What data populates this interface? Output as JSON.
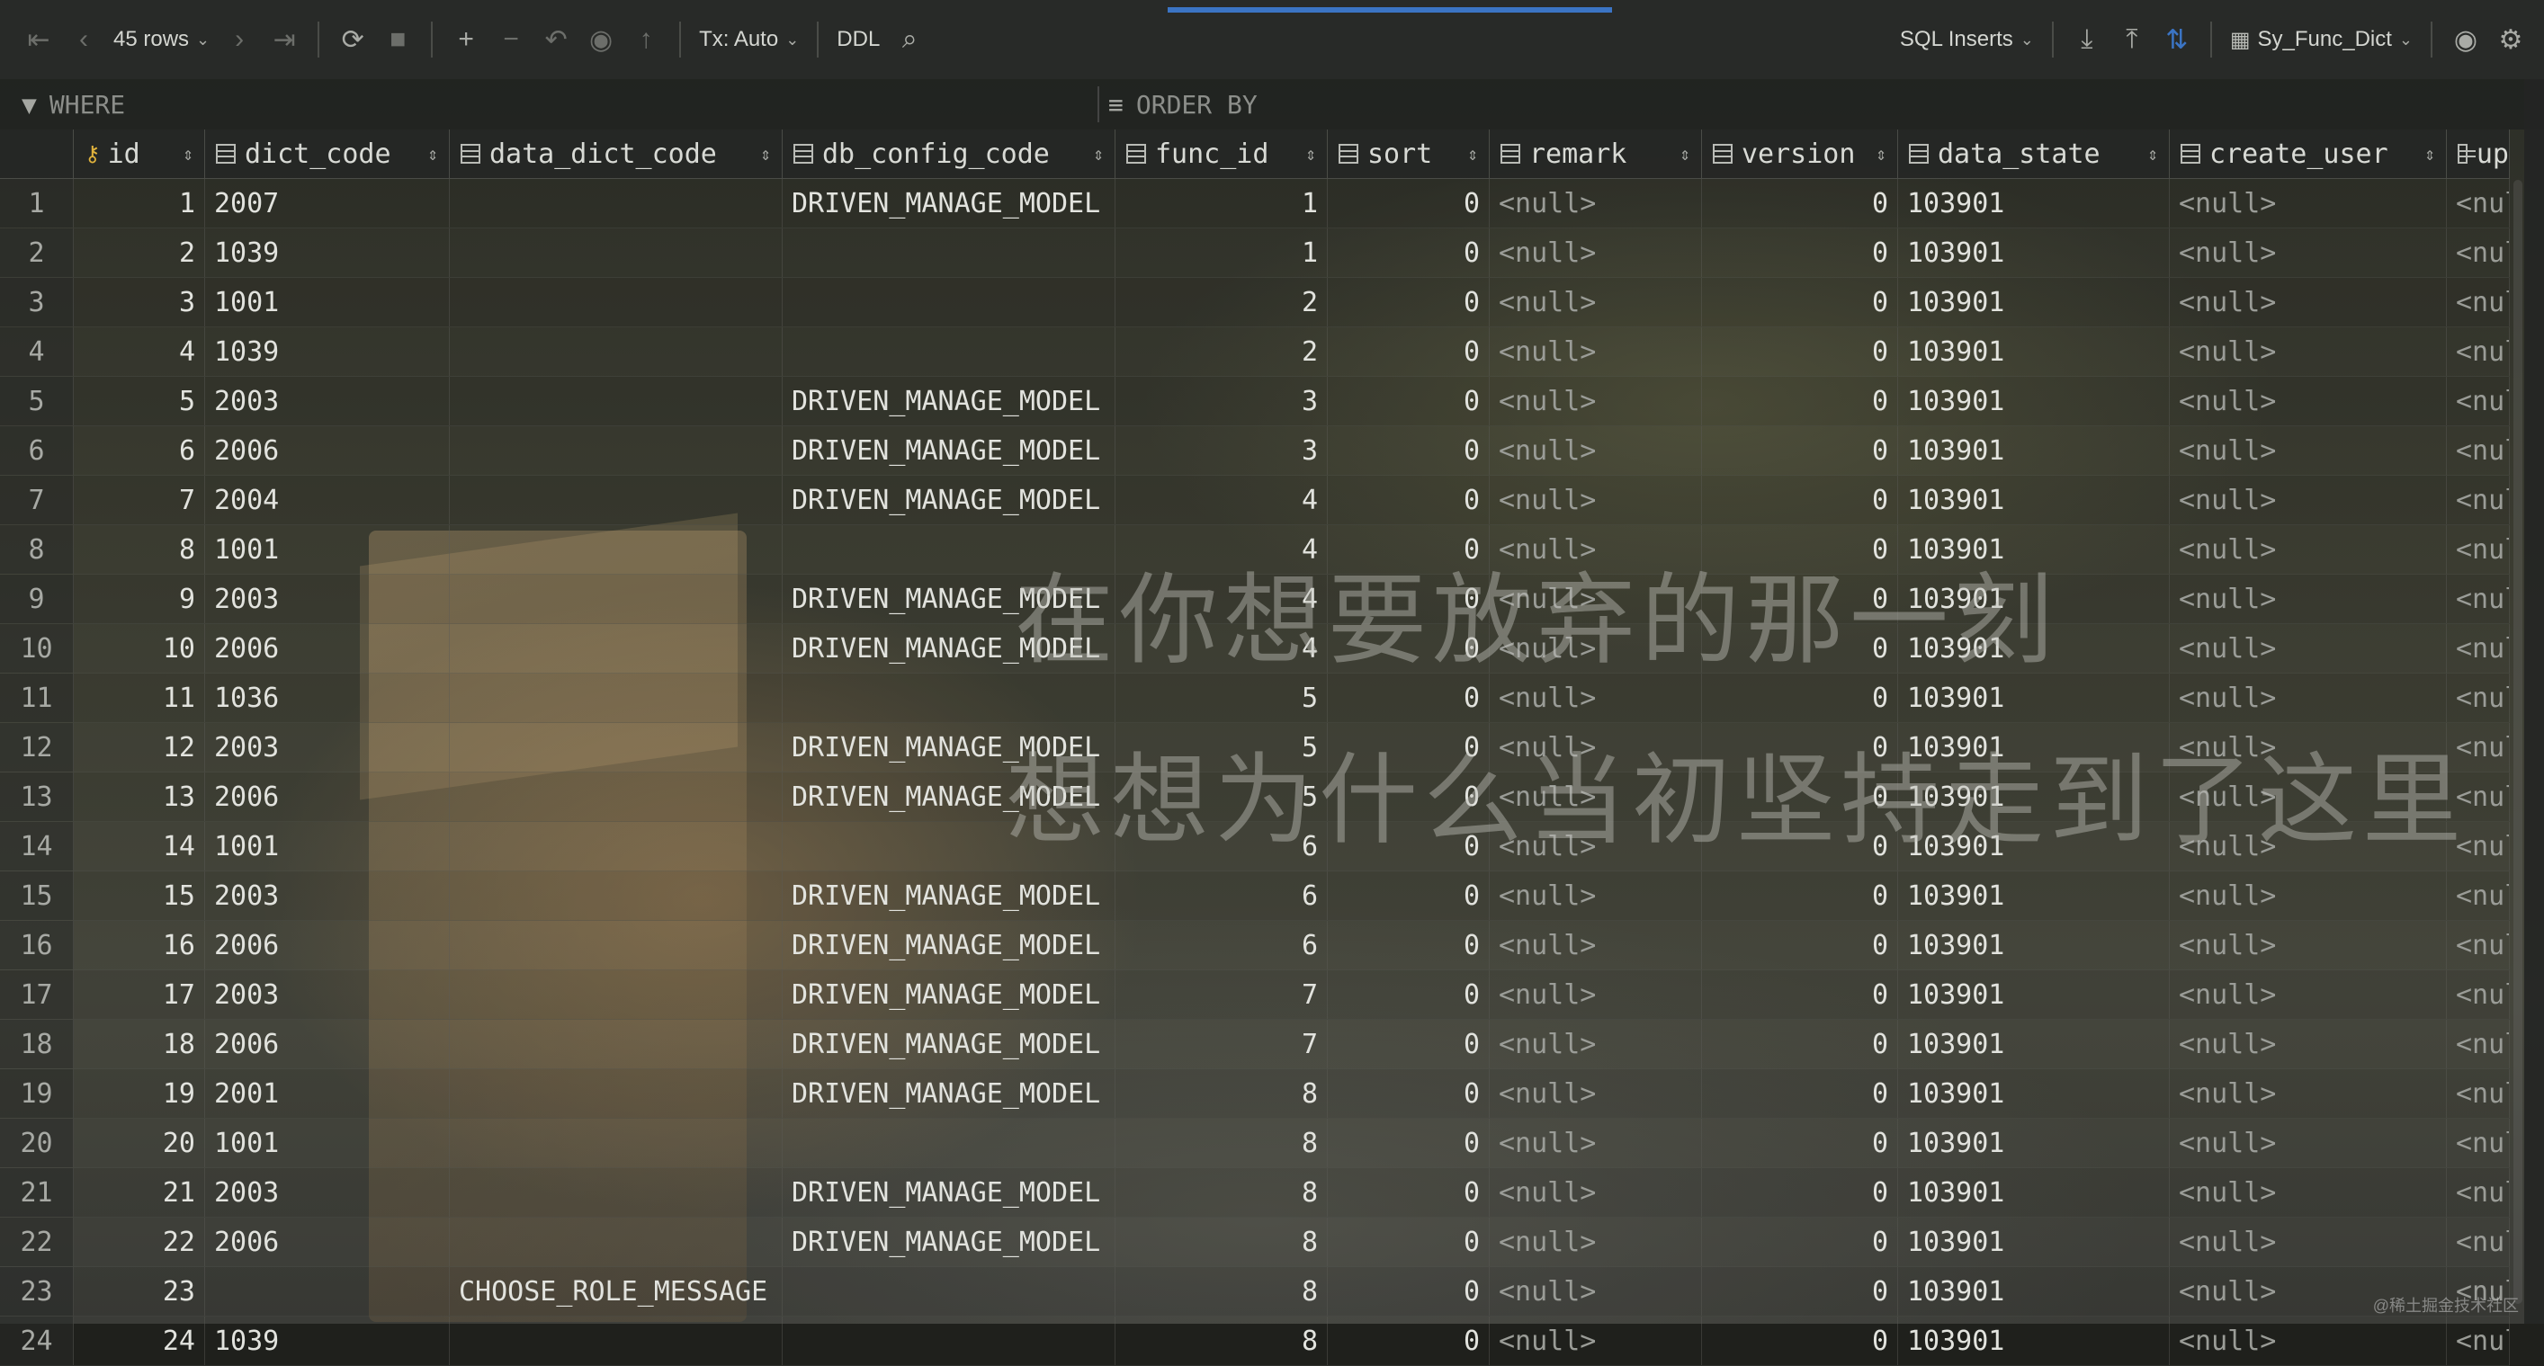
{
  "toolbar": {
    "rows_label": "45 rows",
    "tx_label": "Tx: Auto",
    "ddl_label": "DDL",
    "export_format": "SQL Inserts",
    "table_name": "Sy_Func_Dict"
  },
  "filter": {
    "where_label": "WHERE",
    "order_label": "ORDER BY"
  },
  "columns": [
    "id",
    "dict_code",
    "data_dict_code",
    "db_config_code",
    "func_id",
    "sort",
    "remark",
    "version",
    "data_state",
    "create_user",
    "up"
  ],
  "rows": [
    {
      "rn": "1",
      "id": "1",
      "dict_code": "2007",
      "data_dict_code": "",
      "db_config_code": "DRIVEN_MANAGE_MODEL",
      "func_id": "1",
      "sort": "0",
      "remark": "<null>",
      "version": "0",
      "data_state": "103901",
      "create_user": "<null>",
      "up": "<nul"
    },
    {
      "rn": "2",
      "id": "2",
      "dict_code": "1039",
      "data_dict_code": "",
      "db_config_code": "",
      "func_id": "1",
      "sort": "0",
      "remark": "<null>",
      "version": "0",
      "data_state": "103901",
      "create_user": "<null>",
      "up": "<nul"
    },
    {
      "rn": "3",
      "id": "3",
      "dict_code": "1001",
      "data_dict_code": "",
      "db_config_code": "",
      "func_id": "2",
      "sort": "0",
      "remark": "<null>",
      "version": "0",
      "data_state": "103901",
      "create_user": "<null>",
      "up": "<nul"
    },
    {
      "rn": "4",
      "id": "4",
      "dict_code": "1039",
      "data_dict_code": "",
      "db_config_code": "",
      "func_id": "2",
      "sort": "0",
      "remark": "<null>",
      "version": "0",
      "data_state": "103901",
      "create_user": "<null>",
      "up": "<nul"
    },
    {
      "rn": "5",
      "id": "5",
      "dict_code": "2003",
      "data_dict_code": "",
      "db_config_code": "DRIVEN_MANAGE_MODEL",
      "func_id": "3",
      "sort": "0",
      "remark": "<null>",
      "version": "0",
      "data_state": "103901",
      "create_user": "<null>",
      "up": "<nul"
    },
    {
      "rn": "6",
      "id": "6",
      "dict_code": "2006",
      "data_dict_code": "",
      "db_config_code": "DRIVEN_MANAGE_MODEL",
      "func_id": "3",
      "sort": "0",
      "remark": "<null>",
      "version": "0",
      "data_state": "103901",
      "create_user": "<null>",
      "up": "<nul"
    },
    {
      "rn": "7",
      "id": "7",
      "dict_code": "2004",
      "data_dict_code": "",
      "db_config_code": "DRIVEN_MANAGE_MODEL",
      "func_id": "4",
      "sort": "0",
      "remark": "<null>",
      "version": "0",
      "data_state": "103901",
      "create_user": "<null>",
      "up": "<nul"
    },
    {
      "rn": "8",
      "id": "8",
      "dict_code": "1001",
      "data_dict_code": "",
      "db_config_code": "",
      "func_id": "4",
      "sort": "0",
      "remark": "<null>",
      "version": "0",
      "data_state": "103901",
      "create_user": "<null>",
      "up": "<nul"
    },
    {
      "rn": "9",
      "id": "9",
      "dict_code": "2003",
      "data_dict_code": "",
      "db_config_code": "DRIVEN_MANAGE_MODEL",
      "func_id": "4",
      "sort": "0",
      "remark": "<null>",
      "version": "0",
      "data_state": "103901",
      "create_user": "<null>",
      "up": "<nul"
    },
    {
      "rn": "10",
      "id": "10",
      "dict_code": "2006",
      "data_dict_code": "",
      "db_config_code": "DRIVEN_MANAGE_MODEL",
      "func_id": "4",
      "sort": "0",
      "remark": "<null>",
      "version": "0",
      "data_state": "103901",
      "create_user": "<null>",
      "up": "<nul"
    },
    {
      "rn": "11",
      "id": "11",
      "dict_code": "1036",
      "data_dict_code": "",
      "db_config_code": "",
      "func_id": "5",
      "sort": "0",
      "remark": "<null>",
      "version": "0",
      "data_state": "103901",
      "create_user": "<null>",
      "up": "<nul"
    },
    {
      "rn": "12",
      "id": "12",
      "dict_code": "2003",
      "data_dict_code": "",
      "db_config_code": "DRIVEN_MANAGE_MODEL",
      "func_id": "5",
      "sort": "0",
      "remark": "<null>",
      "version": "0",
      "data_state": "103901",
      "create_user": "<null>",
      "up": "<nul"
    },
    {
      "rn": "13",
      "id": "13",
      "dict_code": "2006",
      "data_dict_code": "",
      "db_config_code": "DRIVEN_MANAGE_MODEL",
      "func_id": "5",
      "sort": "0",
      "remark": "<null>",
      "version": "0",
      "data_state": "103901",
      "create_user": "<null>",
      "up": "<nul"
    },
    {
      "rn": "14",
      "id": "14",
      "dict_code": "1001",
      "data_dict_code": "",
      "db_config_code": "",
      "func_id": "6",
      "sort": "0",
      "remark": "<null>",
      "version": "0",
      "data_state": "103901",
      "create_user": "<null>",
      "up": "<nul"
    },
    {
      "rn": "15",
      "id": "15",
      "dict_code": "2003",
      "data_dict_code": "",
      "db_config_code": "DRIVEN_MANAGE_MODEL",
      "func_id": "6",
      "sort": "0",
      "remark": "<null>",
      "version": "0",
      "data_state": "103901",
      "create_user": "<null>",
      "up": "<nul"
    },
    {
      "rn": "16",
      "id": "16",
      "dict_code": "2006",
      "data_dict_code": "",
      "db_config_code": "DRIVEN_MANAGE_MODEL",
      "func_id": "6",
      "sort": "0",
      "remark": "<null>",
      "version": "0",
      "data_state": "103901",
      "create_user": "<null>",
      "up": "<nul"
    },
    {
      "rn": "17",
      "id": "17",
      "dict_code": "2003",
      "data_dict_code": "",
      "db_config_code": "DRIVEN_MANAGE_MODEL",
      "func_id": "7",
      "sort": "0",
      "remark": "<null>",
      "version": "0",
      "data_state": "103901",
      "create_user": "<null>",
      "up": "<nul"
    },
    {
      "rn": "18",
      "id": "18",
      "dict_code": "2006",
      "data_dict_code": "",
      "db_config_code": "DRIVEN_MANAGE_MODEL",
      "func_id": "7",
      "sort": "0",
      "remark": "<null>",
      "version": "0",
      "data_state": "103901",
      "create_user": "<null>",
      "up": "<nul"
    },
    {
      "rn": "19",
      "id": "19",
      "dict_code": "2001",
      "data_dict_code": "",
      "db_config_code": "DRIVEN_MANAGE_MODEL",
      "func_id": "8",
      "sort": "0",
      "remark": "<null>",
      "version": "0",
      "data_state": "103901",
      "create_user": "<null>",
      "up": "<nul"
    },
    {
      "rn": "20",
      "id": "20",
      "dict_code": "1001",
      "data_dict_code": "",
      "db_config_code": "",
      "func_id": "8",
      "sort": "0",
      "remark": "<null>",
      "version": "0",
      "data_state": "103901",
      "create_user": "<null>",
      "up": "<nul"
    },
    {
      "rn": "21",
      "id": "21",
      "dict_code": "2003",
      "data_dict_code": "",
      "db_config_code": "DRIVEN_MANAGE_MODEL",
      "func_id": "8",
      "sort": "0",
      "remark": "<null>",
      "version": "0",
      "data_state": "103901",
      "create_user": "<null>",
      "up": "<nul"
    },
    {
      "rn": "22",
      "id": "22",
      "dict_code": "2006",
      "data_dict_code": "",
      "db_config_code": "DRIVEN_MANAGE_MODEL",
      "func_id": "8",
      "sort": "0",
      "remark": "<null>",
      "version": "0",
      "data_state": "103901",
      "create_user": "<null>",
      "up": "<nul"
    },
    {
      "rn": "23",
      "id": "23",
      "dict_code": "",
      "data_dict_code": "CHOOSE_ROLE_MESSAGE",
      "db_config_code": "",
      "func_id": "8",
      "sort": "0",
      "remark": "<null>",
      "version": "0",
      "data_state": "103901",
      "create_user": "<null>",
      "up": "<nul"
    },
    {
      "rn": "24",
      "id": "24",
      "dict_code": "1039",
      "data_dict_code": "",
      "db_config_code": "",
      "func_id": "8",
      "sort": "0",
      "remark": "<null>",
      "version": "0",
      "data_state": "103901",
      "create_user": "<null>",
      "up": "<nul"
    }
  ],
  "overlay": {
    "subtitle_line1": "在你想要放弃的那一刻",
    "subtitle_line2": "想想为什么当初坚持走到了这里",
    "credit": "@稀土掘金技术社区"
  },
  "icons": {
    "first_page": "first-page-icon",
    "prev_page": "prev-page-icon",
    "next_page": "next-page-icon",
    "last_page": "last-page-icon",
    "refresh": "refresh-icon",
    "stop": "stop-icon",
    "add_row": "add-row-icon",
    "delete_row": "delete-row-icon",
    "revert": "revert-icon",
    "preview": "preview-changes-icon",
    "submit": "submit-icon",
    "search": "search-icon",
    "download": "download-icon",
    "upload": "upload-icon",
    "compare": "compare-icon",
    "view": "eye-icon",
    "settings": "gear-icon",
    "filter": "filter-icon",
    "sort": "sort-icon",
    "key": "primary-key-icon"
  },
  "colors": {
    "accent": "#3b74c4",
    "null_text": "#9a9c97"
  }
}
